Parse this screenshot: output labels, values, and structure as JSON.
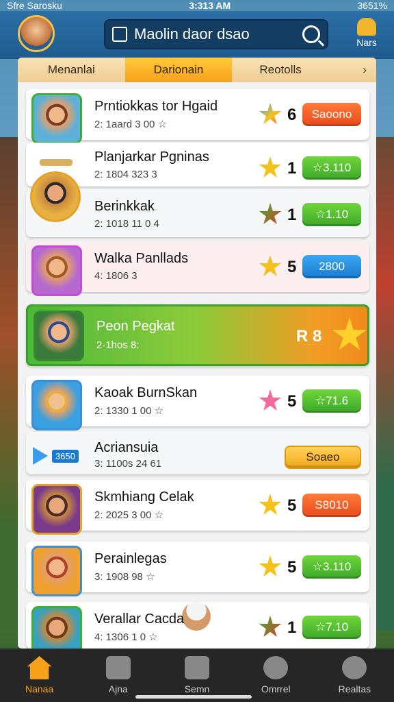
{
  "status": {
    "left": "Sfre Sarosku",
    "time": "3:313 AM",
    "battery": "3651%"
  },
  "header": {
    "search_value": "Maolin daor dsao",
    "notif_label": "Nars"
  },
  "tabs": [
    {
      "label": "Menanlai"
    },
    {
      "label": "Darionain"
    },
    {
      "label": "Reotolls"
    }
  ],
  "rows": [
    {
      "name": "Prntiokkas tor Hgaid",
      "sub": "2: 1aard 3 00 ☆",
      "count": "6",
      "button": "Saoono"
    },
    {
      "name": "Planjarkar Pgninas",
      "sub": "2: 1804 323 3",
      "count": "1",
      "button": "☆3.110"
    },
    {
      "name": "Berinkkak",
      "sub": "2: 1018 11 0 4",
      "count": "1",
      "button": "☆1.10"
    },
    {
      "name": "Walka Panllads",
      "sub": "4: 1806 3",
      "count": "5",
      "button": "2800"
    },
    {
      "name": "Peon Pegkat",
      "sub": "2·1hos 8:",
      "count": "R 8",
      "button": ""
    },
    {
      "name": "Kaoak BurnSkan",
      "sub": "2: 1330 1 00 ☆",
      "count": "5",
      "button": "☆71.6"
    },
    {
      "name": "Acriansuia",
      "sub": "3: 1100s 24 61",
      "count": "",
      "button": "Soaeo",
      "badge": "3650"
    },
    {
      "name": "Skmhiang Celak",
      "sub": "2: 2025 3 00 ☆",
      "count": "5",
      "button": "S8010"
    },
    {
      "name": "Perainlegas",
      "sub": "3: 1908 98 ☆",
      "count": "5",
      "button": "☆3.110"
    },
    {
      "name": "Verallar Cacda",
      "sub": "4: 1306 1 0 ☆",
      "count": "1",
      "button": "☆7.10"
    }
  ],
  "nav": [
    {
      "label": "Nanaa"
    },
    {
      "label": "Ajna"
    },
    {
      "label": "Semn"
    },
    {
      "label": "Omrrel"
    },
    {
      "label": "Realtas"
    }
  ]
}
